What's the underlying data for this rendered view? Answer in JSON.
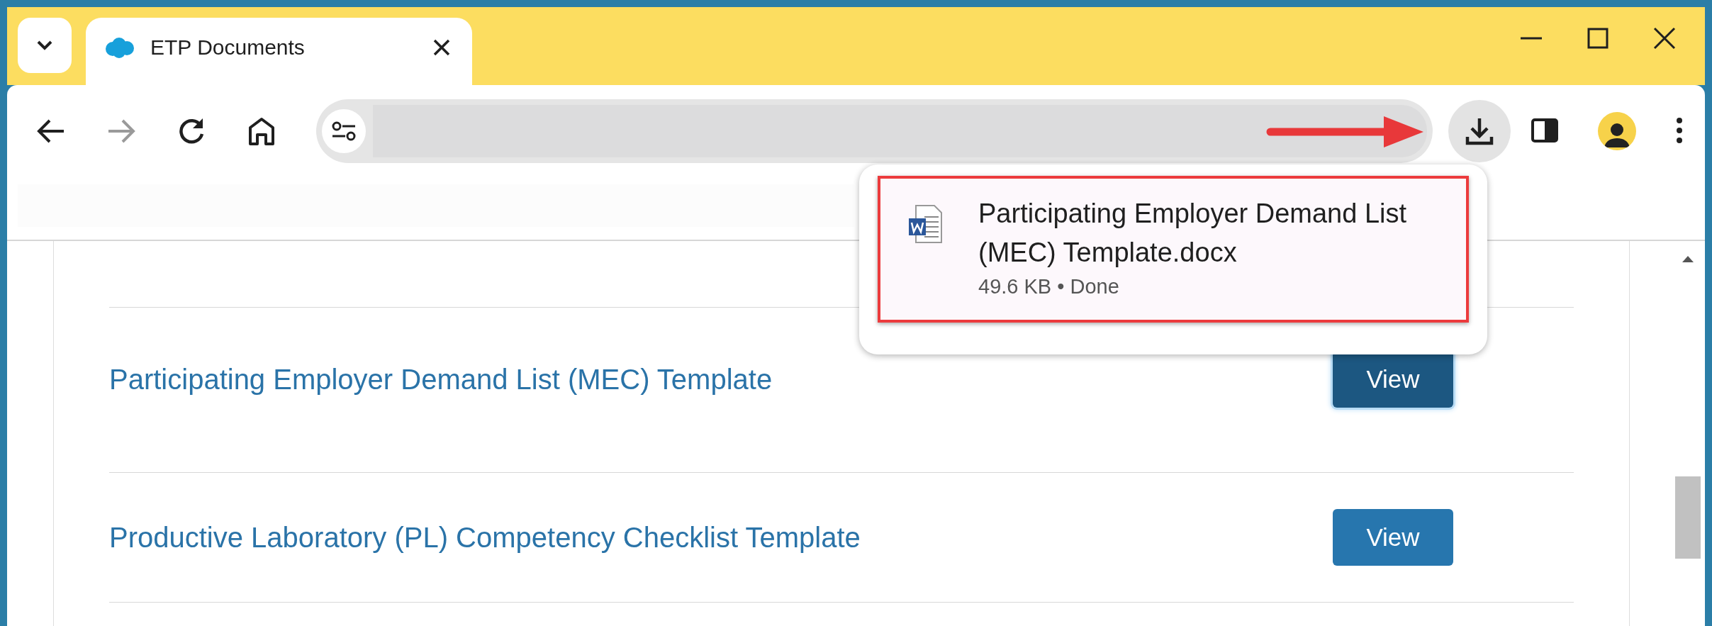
{
  "tab": {
    "title": "ETP Documents",
    "selected": true
  },
  "navigation": {
    "forward_enabled": false
  },
  "download_popup": {
    "file_name": "Participating Employer Demand List (MEC) Template.docx",
    "details": "49.6 KB • Done",
    "highlighted": true
  },
  "annotation_arrow": true,
  "documents": [
    {
      "title": "Participating Employer Demand List (MEC) Template",
      "button": "View",
      "focused": true
    },
    {
      "title": "Productive Laboratory (PL) Competency Checklist Template",
      "button": "View",
      "focused": false
    }
  ]
}
